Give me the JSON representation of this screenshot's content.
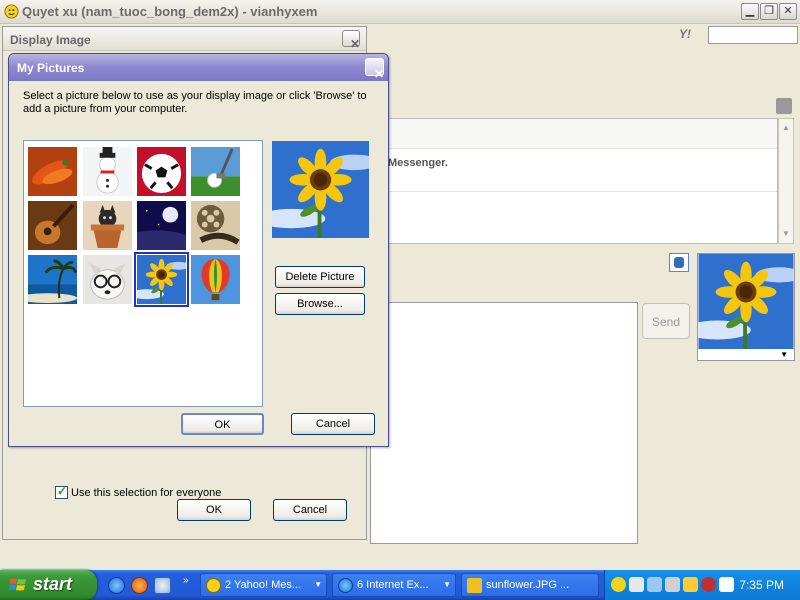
{
  "main_window": {
    "title": "Quyet xu (nam_tuoc_bong_dem2x) - vianhyxem",
    "conversation_text": "Messenger.",
    "send_label": "Send"
  },
  "display_image_dialog": {
    "title": "Display Image",
    "checkbox_label": "Use this selection for everyone",
    "ok_label": "OK",
    "cancel_label": "Cancel"
  },
  "my_pictures_dialog": {
    "title": "My Pictures",
    "instructions": "Select a picture below to use as your display image or click 'Browse' to add a picture from your computer.",
    "thumbnails": [
      "chili peppers",
      "snowman",
      "soccer ball",
      "golf ball",
      "guitar",
      "cat in flower pot",
      "moon",
      "film reel",
      "palm beach",
      "dog with glasses",
      "sunflower",
      "hot air balloon"
    ],
    "selected_thumbnail": "sunflower",
    "delete_label": "Delete Picture",
    "browse_label": "Browse...",
    "ok_label": "OK",
    "cancel_label": "Cancel"
  },
  "taskbar": {
    "start_label": "start",
    "tasks": [
      {
        "label": "2 Yahoo! Mes..."
      },
      {
        "label": "6 Internet Ex..."
      },
      {
        "label": "sunflower.JPG ..."
      }
    ],
    "clock": "7:35 PM"
  },
  "colors": {
    "taskbar_blue": "#245edb",
    "start_green": "#3c9a38",
    "dialog_title_purple": "#8f8ad0",
    "selection_blue": "#1a33d6"
  }
}
